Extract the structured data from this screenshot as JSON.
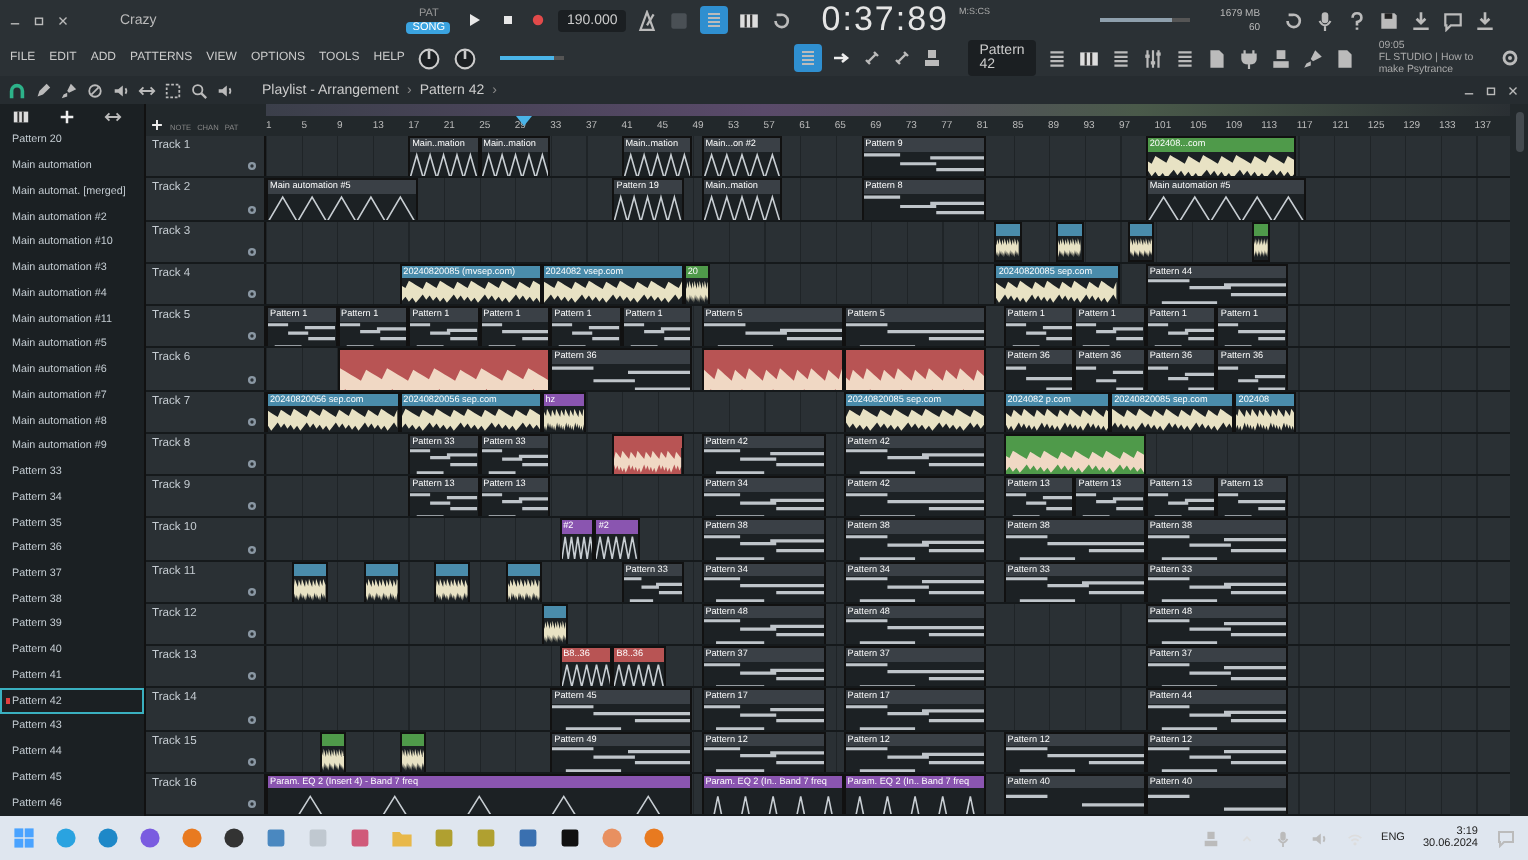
{
  "window": {
    "title": "Crazy"
  },
  "transport": {
    "modes": [
      {
        "label": "PAT",
        "selected": false
      },
      {
        "label": "SONG",
        "selected": true
      }
    ],
    "playing": false,
    "recording": true,
    "tempo": "190.000",
    "time": "0:37:89",
    "time_unit": "M:S:CS",
    "volume": {
      "level": 0.8
    },
    "memory": "1679 MB",
    "cpu": "60"
  },
  "menu": [
    "FILE",
    "EDIT",
    "ADD",
    "PATTERNS",
    "VIEW",
    "OPTIONS",
    "TOOLS",
    "HELP"
  ],
  "pitch": {
    "level": 0.85
  },
  "pattern_selector": "Pattern 42",
  "hint": {
    "time": "09:05",
    "text": "FL STUDIO | How to make Psytrance"
  },
  "playlist": {
    "breadcrumb": [
      "Playlist - Arrangement",
      "›",
      "Pattern 42",
      "›"
    ],
    "header_tabs": [
      "NOTE",
      "CHAN",
      "PAT"
    ],
    "ruler": [
      "1",
      "5",
      "9",
      "13",
      "17",
      "21",
      "25",
      "29",
      "33",
      "37",
      "41",
      "45",
      "49",
      "53",
      "57",
      "61",
      "65",
      "69",
      "73",
      "77",
      "81",
      "85",
      "89",
      "93",
      "97",
      "101",
      "105",
      "109",
      "113",
      "117",
      "121",
      "125",
      "129",
      "133",
      "137"
    ]
  },
  "browser": [
    {
      "label": "Pattern 20",
      "selected": false
    },
    {
      "label": "Main automation",
      "selected": false
    },
    {
      "label": "Main automat. [merged]",
      "selected": false
    },
    {
      "label": "Main automation #2",
      "selected": false
    },
    {
      "label": "Main automation #10",
      "selected": false
    },
    {
      "label": "Main automation #3",
      "selected": false
    },
    {
      "label": "Main automation #4",
      "selected": false
    },
    {
      "label": "Main automation #11",
      "selected": false
    },
    {
      "label": "Main automation #5",
      "selected": false
    },
    {
      "label": "Main automation #6",
      "selected": false
    },
    {
      "label": "Main automation #7",
      "selected": false
    },
    {
      "label": "Main automation #8",
      "selected": false
    },
    {
      "label": "Main automation #9",
      "selected": false
    },
    {
      "label": "Pattern 33",
      "selected": false
    },
    {
      "label": "Pattern 34",
      "selected": false
    },
    {
      "label": "Pattern 35",
      "selected": false
    },
    {
      "label": "Pattern 36",
      "selected": false
    },
    {
      "label": "Pattern 37",
      "selected": false
    },
    {
      "label": "Pattern 38",
      "selected": false
    },
    {
      "label": "Pattern 39",
      "selected": false
    },
    {
      "label": "Pattern 40",
      "selected": false
    },
    {
      "label": "Pattern 41",
      "selected": false
    },
    {
      "label": "Pattern 42",
      "selected": true
    },
    {
      "label": "Pattern 43",
      "selected": false
    },
    {
      "label": "Pattern 44",
      "selected": false
    },
    {
      "label": "Pattern 45",
      "selected": false
    },
    {
      "label": "Pattern 46",
      "selected": false
    }
  ],
  "tracks": [
    {
      "name": "Track 1",
      "clips": [
        {
          "kind": "automation",
          "label": "Main..mation",
          "color": "#3a4046"
        },
        {
          "kind": "automation",
          "label": "Main..mation",
          "color": "#3a4046"
        },
        {
          "kind": "automation",
          "label": "Main..mation",
          "color": "#3a4046"
        },
        {
          "kind": "automation",
          "label": "Main...on #2",
          "color": "#3a4046"
        },
        {
          "kind": "pattern",
          "label": "Pattern 9",
          "color": "#3a4046"
        },
        {
          "kind": "audio",
          "label": "202408...com",
          "color": "#4f9a4a"
        }
      ]
    },
    {
      "name": "Track 2",
      "clips": [
        {
          "kind": "automation",
          "label": "Main automation #5",
          "color": "#3a4046"
        },
        {
          "kind": "automation",
          "label": "Pattern 19",
          "color": "#3a4046"
        },
        {
          "kind": "automation",
          "label": "Main..mation",
          "color": "#3a4046"
        },
        {
          "kind": "pattern",
          "label": "Pattern 8",
          "color": "#3a4046"
        },
        {
          "kind": "automation",
          "label": "Main automation #5",
          "color": "#3a4046"
        }
      ]
    },
    {
      "name": "Track 3",
      "clips": [
        {
          "kind": "audio",
          "color": "#4a8cab"
        },
        {
          "kind": "audio",
          "color": "#4a8cab"
        },
        {
          "kind": "audio",
          "color": "#4a8cab"
        },
        {
          "kind": "audio",
          "color": "#4f9a4a"
        }
      ]
    },
    {
      "name": "Track 4",
      "clips": [
        {
          "kind": "audio",
          "label": "20240820085 (mvsep.com)",
          "color": "#4a8cab"
        },
        {
          "kind": "audio",
          "label": "2024082 vsep.com",
          "color": "#4a8cab"
        },
        {
          "kind": "audio",
          "label": "20",
          "color": "#4f9a4a"
        },
        {
          "kind": "audio",
          "label": "20240820085 sep.com",
          "color": "#4a8cab"
        },
        {
          "kind": "pattern",
          "label": "Pattern 44",
          "color": "#3a4046"
        }
      ]
    },
    {
      "name": "Track 5",
      "clips": [
        {
          "kind": "pattern",
          "label": "Pattern 1",
          "color": "#3a4046"
        },
        {
          "kind": "pattern",
          "label": "Pattern 1",
          "color": "#3a4046"
        },
        {
          "kind": "pattern",
          "label": "Pattern 1",
          "color": "#3a4046"
        },
        {
          "kind": "pattern",
          "label": "Pattern 1",
          "color": "#3a4046"
        },
        {
          "kind": "pattern",
          "label": "Pattern 1",
          "color": "#3a4046"
        },
        {
          "kind": "pattern",
          "label": "Pattern 1",
          "color": "#3a4046"
        },
        {
          "kind": "pattern",
          "label": "Pattern 5",
          "color": "#3a4046"
        },
        {
          "kind": "pattern",
          "label": "Pattern 5",
          "color": "#3a4046"
        },
        {
          "kind": "pattern",
          "label": "Pattern 1",
          "color": "#3a4046"
        },
        {
          "kind": "pattern",
          "label": "Pattern 1",
          "color": "#3a4046"
        },
        {
          "kind": "pattern",
          "label": "Pattern 1",
          "color": "#3a4046"
        },
        {
          "kind": "pattern",
          "label": "Pattern 1",
          "color": "#3a4046"
        }
      ]
    },
    {
      "name": "Track 6",
      "clips": [
        {
          "kind": "block",
          "color": "#b85454"
        },
        {
          "kind": "pattern",
          "label": "Pattern 36",
          "color": "#3a4046"
        },
        {
          "kind": "block",
          "color": "#b85454"
        },
        {
          "kind": "block",
          "color": "#b85454"
        },
        {
          "kind": "pattern",
          "label": "Pattern 36",
          "color": "#3a4046"
        },
        {
          "kind": "pattern",
          "label": "Pattern 36",
          "color": "#3a4046"
        },
        {
          "kind": "pattern",
          "label": "Pattern 36",
          "color": "#3a4046"
        },
        {
          "kind": "pattern",
          "label": "Pattern 36",
          "color": "#3a4046"
        }
      ]
    },
    {
      "name": "Track 7",
      "clips": [
        {
          "kind": "audio",
          "label": "20240820056 sep.com",
          "color": "#4a8cab"
        },
        {
          "kind": "audio",
          "label": "20240820056 sep.com",
          "color": "#4a8cab"
        },
        {
          "kind": "audio",
          "label": "hz",
          "color": "#8a55b0"
        },
        {
          "kind": "audio",
          "label": "20240820085 sep.com",
          "color": "#4a8cab"
        },
        {
          "kind": "audio",
          "label": "2024082 p.com",
          "color": "#4a8cab"
        },
        {
          "kind": "audio",
          "label": "20240820085 sep.com",
          "color": "#4a8cab"
        },
        {
          "kind": "audio",
          "label": "202408",
          "color": "#4a8cab"
        }
      ]
    },
    {
      "name": "Track 8",
      "clips": [
        {
          "kind": "pattern",
          "label": "Pattern 33",
          "color": "#3a4046"
        },
        {
          "kind": "pattern",
          "label": "Pattern 33",
          "color": "#3a4046"
        },
        {
          "kind": "block",
          "color": "#b85454"
        },
        {
          "kind": "pattern",
          "label": "Pattern 42",
          "color": "#3a4046"
        },
        {
          "kind": "pattern",
          "label": "Pattern 42",
          "color": "#3a4046"
        },
        {
          "kind": "block",
          "color": "#4f9a4a"
        }
      ]
    },
    {
      "name": "Track 9",
      "clips": [
        {
          "kind": "pattern",
          "label": "Pattern 13",
          "color": "#3a4046"
        },
        {
          "kind": "pattern",
          "label": "Pattern 13",
          "color": "#3a4046"
        },
        {
          "kind": "pattern",
          "label": "Pattern 34",
          "color": "#3a4046"
        },
        {
          "kind": "pattern",
          "label": "Pattern 42",
          "color": "#3a4046"
        },
        {
          "kind": "pattern",
          "label": "Pattern 13",
          "color": "#3a4046"
        },
        {
          "kind": "pattern",
          "label": "Pattern 13",
          "color": "#3a4046"
        },
        {
          "kind": "pattern",
          "label": "Pattern 13",
          "color": "#3a4046"
        },
        {
          "kind": "pattern",
          "label": "Pattern 13",
          "color": "#3a4046"
        }
      ]
    },
    {
      "name": "Track 10",
      "clips": [
        {
          "kind": "automation",
          "label": "#2",
          "color": "#8a55b0"
        },
        {
          "kind": "automation",
          "label": "#2",
          "color": "#8a55b0"
        },
        {
          "kind": "pattern",
          "label": "Pattern 38",
          "color": "#3a4046"
        },
        {
          "kind": "pattern",
          "label": "Pattern 38",
          "color": "#3a4046"
        },
        {
          "kind": "pattern",
          "label": "Pattern 38",
          "color": "#3a4046"
        },
        {
          "kind": "pattern",
          "label": "Pattern 38",
          "color": "#3a4046"
        }
      ]
    },
    {
      "name": "Track 11",
      "clips": [
        {
          "kind": "audio",
          "color": "#4a8cab"
        },
        {
          "kind": "audio",
          "color": "#4a8cab"
        },
        {
          "kind": "audio",
          "color": "#4a8cab"
        },
        {
          "kind": "audio",
          "color": "#4a8cab"
        },
        {
          "kind": "pattern",
          "label": "Pattern 33",
          "color": "#3a4046"
        },
        {
          "kind": "pattern",
          "label": "Pattern 34",
          "color": "#3a4046"
        },
        {
          "kind": "pattern",
          "label": "Pattern 34",
          "color": "#3a4046"
        },
        {
          "kind": "pattern",
          "label": "Pattern 33",
          "color": "#3a4046"
        },
        {
          "kind": "pattern",
          "label": "Pattern 33",
          "color": "#3a4046"
        }
      ]
    },
    {
      "name": "Track 12",
      "clips": [
        {
          "kind": "audio",
          "color": "#4a8cab"
        },
        {
          "kind": "pattern",
          "label": "Pattern 48",
          "color": "#3a4046"
        },
        {
          "kind": "pattern",
          "label": "Pattern 48",
          "color": "#3a4046"
        },
        {
          "kind": "pattern",
          "label": "Pattern 48",
          "color": "#3a4046"
        }
      ]
    },
    {
      "name": "Track 13",
      "clips": [
        {
          "kind": "automation",
          "label": "B8..36",
          "color": "#b85454"
        },
        {
          "kind": "automation",
          "label": "B8..36",
          "color": "#b85454"
        },
        {
          "kind": "pattern",
          "label": "Pattern 37",
          "color": "#3a4046"
        },
        {
          "kind": "pattern",
          "label": "Pattern 37",
          "color": "#3a4046"
        },
        {
          "kind": "pattern",
          "label": "Pattern 37",
          "color": "#3a4046"
        }
      ]
    },
    {
      "name": "Track 14",
      "clips": [
        {
          "kind": "pattern",
          "label": "Pattern 45",
          "color": "#3a4046"
        },
        {
          "kind": "pattern",
          "label": "Pattern 17",
          "color": "#3a4046"
        },
        {
          "kind": "pattern",
          "label": "Pattern 17",
          "color": "#3a4046"
        },
        {
          "kind": "pattern",
          "label": "Pattern 44",
          "color": "#3a4046"
        }
      ]
    },
    {
      "name": "Track 15",
      "clips": [
        {
          "kind": "audio",
          "color": "#4f9a4a"
        },
        {
          "kind": "audio",
          "color": "#4f9a4a"
        },
        {
          "kind": "pattern",
          "label": "Pattern 49",
          "color": "#3a4046"
        },
        {
          "kind": "pattern",
          "label": "Pattern 12",
          "color": "#3a4046"
        },
        {
          "kind": "pattern",
          "label": "Pattern 12",
          "color": "#3a4046"
        },
        {
          "kind": "pattern",
          "label": "Pattern 12",
          "color": "#3a4046"
        },
        {
          "kind": "pattern",
          "label": "Pattern 12",
          "color": "#3a4046"
        }
      ]
    },
    {
      "name": "Track 16",
      "clips": [
        {
          "kind": "automation",
          "label": "Param. EQ 2 (Insert 4) - Band 7 freq",
          "color": "#8a55b0"
        },
        {
          "kind": "automation",
          "label": "Param. EQ 2 (In.. Band 7 freq",
          "color": "#8a55b0"
        },
        {
          "kind": "automation",
          "label": "Param. EQ 2 (In.. Band 7 freq",
          "color": "#8a55b0"
        },
        {
          "kind": "pattern",
          "label": "Pattern 40",
          "color": "#3a4046"
        },
        {
          "kind": "pattern",
          "label": "Pattern 40",
          "color": "#3a4046"
        }
      ]
    }
  ],
  "taskbar": {
    "language": "ENG",
    "time": "3:19",
    "date": "30.06.2024"
  }
}
